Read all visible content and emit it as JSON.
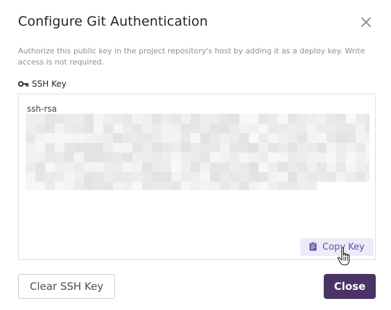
{
  "dialog": {
    "title": "Configure Git Authentication",
    "description": "Authorize this public key in the project repository's host by adding it as a deploy key. Write access is not required."
  },
  "ssh_key": {
    "label": "SSH Key",
    "prefix": "ssh-rsa",
    "copy_label": "Copy Key"
  },
  "footer": {
    "clear_label": "Clear SSH Key",
    "close_label": "Close"
  },
  "colors": {
    "primary": "#4a3466",
    "accent_text": "#5b4ea3",
    "accent_bg": "#eeebf8"
  },
  "icons": {
    "close": "close-icon",
    "key": "key-icon",
    "copy": "clipboard-icon",
    "cursor": "hand-cursor-icon"
  }
}
